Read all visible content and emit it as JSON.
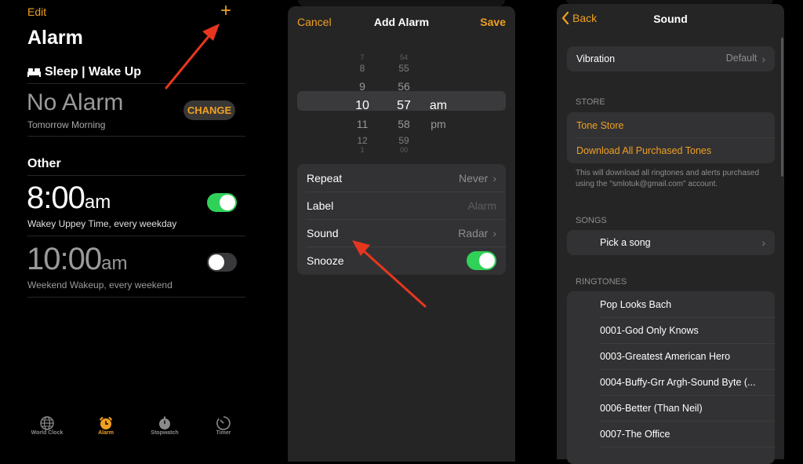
{
  "alarm_list": {
    "edit_label": "Edit",
    "add_icon": "plus-icon",
    "title": "Alarm",
    "sleep_section": {
      "icon": "bed-icon",
      "label": "Sleep | Wake Up"
    },
    "sleep_alarm": {
      "time": "No Alarm",
      "subtitle": "Tomorrow Morning",
      "change_label": "CHANGE"
    },
    "other_label": "Other",
    "alarms": [
      {
        "time": "8:00",
        "ampm": "am",
        "subtitle": "Wakey Uppey Time, every weekday",
        "enabled": true
      },
      {
        "time": "10:00",
        "ampm": "am",
        "subtitle": "Weekend Wakeup, every weekend",
        "enabled": false
      }
    ],
    "tabs": [
      {
        "label": "World Clock",
        "icon": "globe-icon",
        "active": false
      },
      {
        "label": "Alarm",
        "icon": "alarm-clock-icon",
        "active": true
      },
      {
        "label": "Stopwatch",
        "icon": "stopwatch-icon",
        "active": false
      },
      {
        "label": "Timer",
        "icon": "timer-icon",
        "active": false
      }
    ]
  },
  "add_alarm": {
    "cancel_label": "Cancel",
    "title": "Add Alarm",
    "save_label": "Save",
    "picker": {
      "hours": [
        "7",
        "8",
        "9",
        "10",
        "11",
        "12",
        "1"
      ],
      "minutes": [
        "54",
        "55",
        "56",
        "57",
        "58",
        "59",
        "00"
      ],
      "periods": [
        "am",
        "pm"
      ],
      "selected": {
        "hour": "10",
        "minute": "57",
        "period": "am"
      }
    },
    "options": [
      {
        "label": "Repeat",
        "value": "Never",
        "chevron": true
      },
      {
        "label": "Label",
        "value": "Alarm",
        "chevron": false
      },
      {
        "label": "Sound",
        "value": "Radar",
        "chevron": true
      },
      {
        "label": "Snooze",
        "toggle": true
      }
    ]
  },
  "sound": {
    "back_label": "Back",
    "title": "Sound",
    "vibration": {
      "label": "Vibration",
      "value": "Default"
    },
    "store_header": "STORE",
    "store_items": [
      "Tone Store",
      "Download All Purchased Tones"
    ],
    "store_note": "This will download all ringtones and alerts purchased using the \"smlotuk@gmail.com\" account.",
    "songs_header": "SONGS",
    "pick_song": "Pick a song",
    "ringtones_header": "RINGTONES",
    "ringtones": [
      "Pop Looks Bach",
      "0001-God Only Knows",
      "0003-Greatest American Hero",
      "0004-Buffy-Grr Argh-Sound Byte (...",
      "0006-Better (Than Neil)",
      "0007-The Office"
    ]
  },
  "colors": {
    "accent": "#f0a020",
    "toggle_on": "#30d158",
    "annotation_arrow": "#e8361e"
  }
}
